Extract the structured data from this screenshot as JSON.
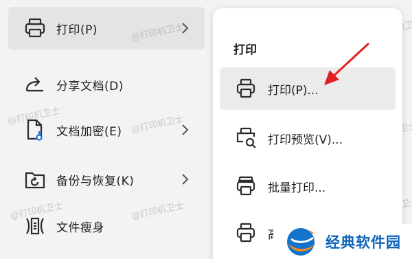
{
  "menu": {
    "items": [
      {
        "label": "打印(P)",
        "icon": "printer-icon",
        "has_submenu": true,
        "active": true
      },
      {
        "label": "分享文档(D)",
        "icon": "share-icon",
        "has_submenu": false
      },
      {
        "label": "文档加密(E)",
        "icon": "document-lock-icon",
        "has_submenu": true
      },
      {
        "label": "备份与恢复(K)",
        "icon": "backup-restore-icon",
        "has_submenu": true
      },
      {
        "label": "文件瘦身",
        "icon": "file-slim-icon",
        "has_submenu": false
      }
    ]
  },
  "submenu": {
    "title": "打印",
    "items": [
      {
        "label": "打印(P)...",
        "icon": "printer-icon",
        "highlighted": true
      },
      {
        "label": "打印预览(V)...",
        "icon": "print-preview-icon"
      },
      {
        "label": "批量打印...",
        "icon": "batch-print-icon"
      },
      {
        "label": "高",
        "icon": "printer-icon"
      }
    ]
  },
  "watermark": "@打印机卫士",
  "brand": {
    "name": "经典软件园",
    "color": "#0e63b8",
    "accent": "#f08c1e"
  },
  "annotation": {
    "arrow_color": "#e02020"
  }
}
